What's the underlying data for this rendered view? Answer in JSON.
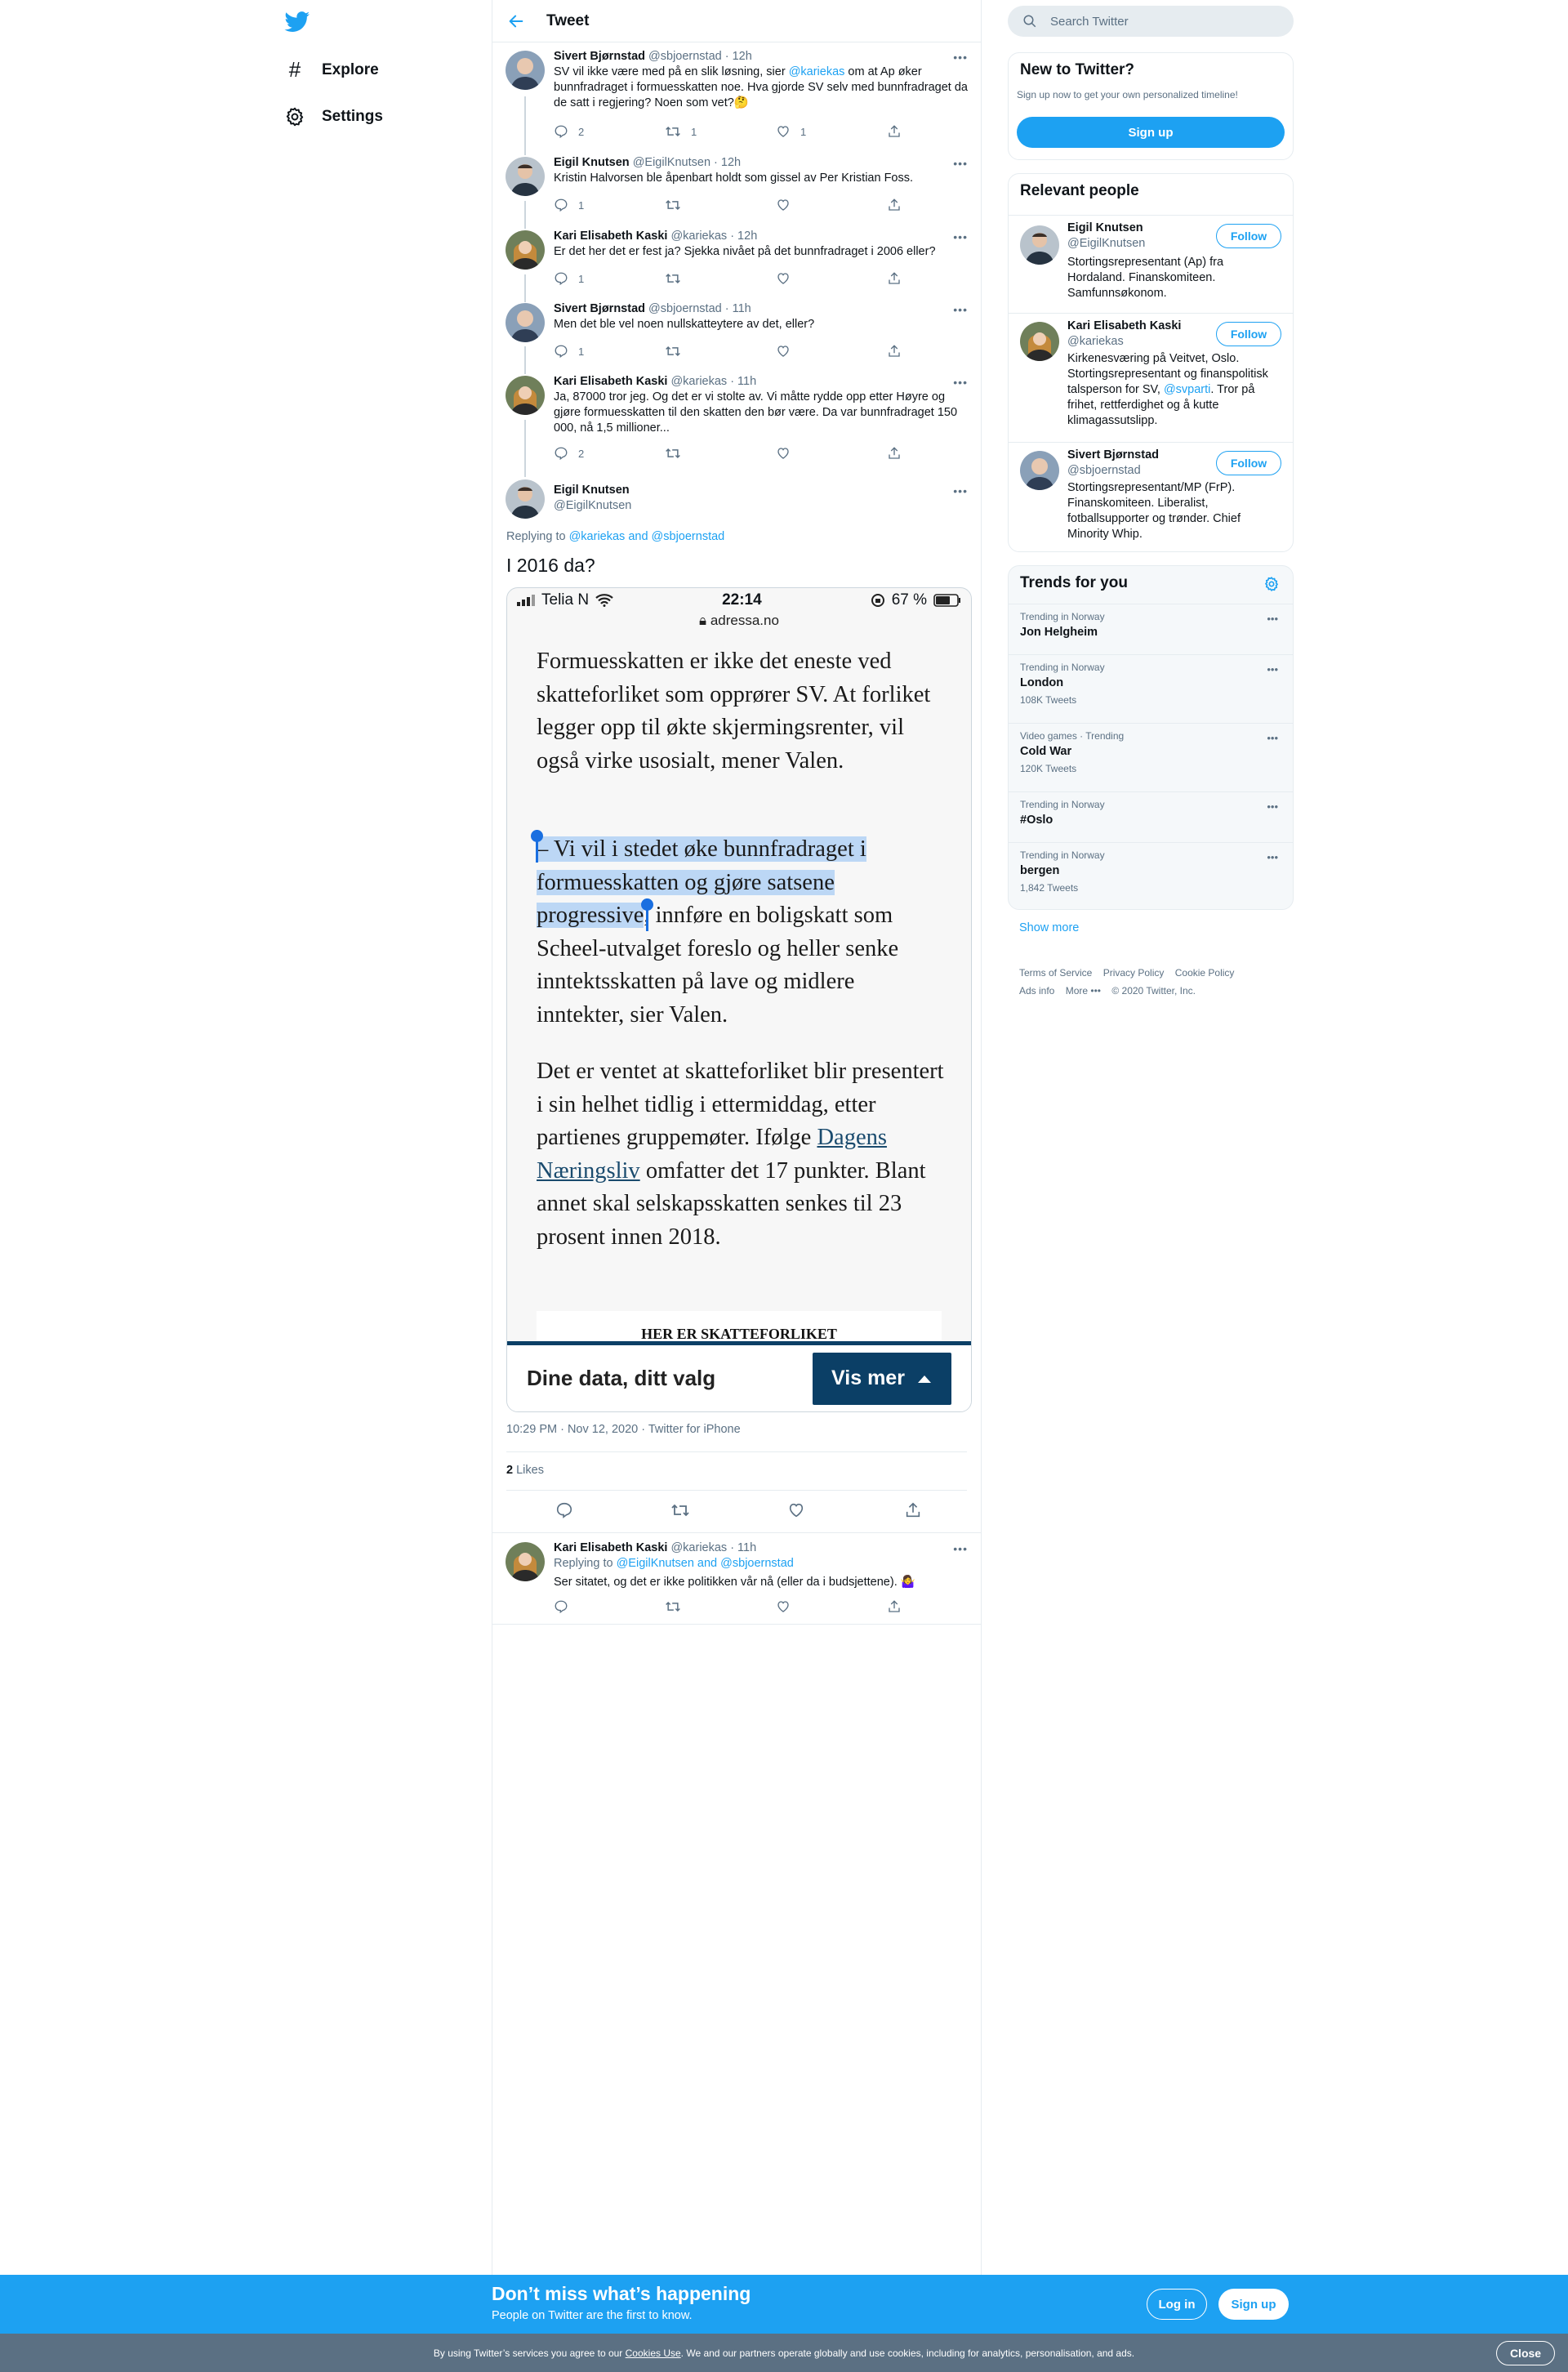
{
  "nav": {
    "explore": "Explore",
    "settings": "Settings"
  },
  "header": {
    "title": "Tweet"
  },
  "tweets": [
    {
      "name": "Sivert Bjørnstad",
      "handle": "@sbjoernstad",
      "time": "· 12h",
      "text_a": "SV vil ikke være med på en slik løsning, sier ",
      "mention": "@kariekas",
      "text_b": " om at Ap øker bunnfradraget i formuesskatten noe. Hva gjorde SV selv med bunnfradraget da de satt i regjering? Noen som vet?🤔",
      "replies": "2",
      "retweets": "1",
      "likes": "1"
    },
    {
      "name": "Eigil Knutsen",
      "handle": "@EigilKnutsen",
      "time": "· 12h",
      "text": "Kristin Halvorsen ble åpenbart holdt som gissel av Per Kristian Foss.",
      "replies": "1",
      "retweets": "",
      "likes": ""
    },
    {
      "name": "Kari Elisabeth Kaski",
      "handle": "@kariekas",
      "time": "· 12h",
      "text": "Er det her det er fest ja? Sjekka nivået på det bunnfradraget i 2006 eller?",
      "replies": "1",
      "retweets": "",
      "likes": ""
    },
    {
      "name": "Sivert Bjørnstad",
      "handle": "@sbjoernstad",
      "time": "· 11h",
      "text": "Men det ble vel noen nullskatteytere av det, eller?",
      "replies": "1",
      "retweets": "",
      "likes": ""
    },
    {
      "name": "Kari Elisabeth Kaski",
      "handle": "@kariekas",
      "time": "· 11h",
      "text": "Ja, 87000 tror jeg. Og det er vi stolte av. Vi måtte rydde opp etter Høyre og gjøre formuesskatten til den skatten den bør være. Da var bunnfradraget 150 000, nå 1,5 millioner...",
      "replies": "2",
      "retweets": "",
      "likes": ""
    }
  ],
  "main": {
    "name": "Eigil Knutsen",
    "handle": "@EigilKnutsen",
    "replying_prefix": "Replying to ",
    "replying_to": "@kariekas and @sbjoernstad",
    "text": "I 2016 da?",
    "meta": "10:29 PM · Nov 12, 2020 · Twitter for iPhone",
    "likes_count": "2",
    "likes_label": "Likes"
  },
  "screenshot": {
    "carrier": "Telia N",
    "time": "22:14",
    "battery": "67 %",
    "url": "adressa.no",
    "p1": "Formuesskatten er ikke det eneste ved skatteforliket som opprører SV. At forliket legger opp til økte skjermingsrenter, vil også virke usosialt, mener Valen.",
    "p2_hl": "– Vi vil i stedet øke bunnfradraget i formuesskatten og gjøre satsene progressive",
    "p2_rest": ", innføre en boligskatt som Scheel-utvalget foreslo og heller senke inntektsskatten på lave og midlere inntekter, sier Valen.",
    "p3_a": "Det er ventet at skatteforliket blir presentert i sin helhet tidlig i ettermiddag, etter partienes gruppemøter. Ifølge ",
    "p3_link": "Dagens Næringsliv",
    "p3_b": " omfatter det 17 punkter. Blant annet skal selskapsskatten senkes til 23 prosent innen 2018.",
    "box_title": "HER ER SKATTEFORLIKET",
    "banner_text": "Dine data, ditt valg",
    "banner_button": "Vis mer"
  },
  "reply": {
    "name": "Kari Elisabeth Kaski",
    "handle": "@kariekas",
    "time": "· 11h",
    "replying_prefix": "Replying to ",
    "replying_to": "@EigilKnutsen and @sbjoernstad",
    "text": "Ser sitatet, og det er ikke politikken vår nå (eller da i budsjettene). 🤷‍♀️"
  },
  "sidebar": {
    "search_placeholder": "Search Twitter",
    "new_title": "New to Twitter?",
    "new_sub": "Sign up now to get your own personalized timeline!",
    "signup": "Sign up",
    "relevant_title": "Relevant people",
    "follow": "Follow",
    "people": [
      {
        "name": "Eigil Knutsen",
        "handle": "@EigilKnutsen",
        "bio": "Stortingsrepresentant (Ap) fra Hordaland. Finanskomiteen. Samfunnsøkonom."
      },
      {
        "name": "Kari Elisabeth Kaski",
        "handle": "@kariekas",
        "bio_a": "Kirkenesværing på Veitvet, Oslo. Stortingsrepresentant og finanspolitisk talsperson for SV, ",
        "bio_link": "@svparti",
        "bio_b": ". Tror på frihet, rettferdighet og å kutte klimagassutslipp."
      },
      {
        "name": "Sivert Bjørnstad",
        "handle": "@sbjoernstad",
        "bio": "Stortingsrepresentant/MP (FrP). Finanskomiteen. Liberalist, fotballsupporter og trønder. Chief Minority Whip."
      }
    ],
    "trends_title": "Trends for you",
    "trends": [
      {
        "context": "Trending in Norway",
        "name": "Jon Helgheim",
        "count": ""
      },
      {
        "context": "Trending in Norway",
        "name": "London",
        "count": "108K Tweets"
      },
      {
        "context": "Video games · Trending",
        "name": "Cold War",
        "count": "120K Tweets"
      },
      {
        "context": "Trending in Norway",
        "name": "#Oslo",
        "count": ""
      },
      {
        "context": "Trending in Norway",
        "name": "bergen",
        "count": "1,842 Tweets"
      }
    ],
    "show_more": "Show more",
    "footer": {
      "terms": "Terms of Service",
      "privacy": "Privacy Policy",
      "cookie": "Cookie Policy",
      "ads": "Ads info",
      "more": "More",
      "copyright": "© 2020 Twitter, Inc."
    }
  },
  "banner": {
    "title": "Don’t miss what’s happening",
    "sub": "People on Twitter are the first to know.",
    "login": "Log in",
    "signup": "Sign up"
  },
  "cookie": {
    "a": "By using Twitter’s services you agree to our ",
    "link": "Cookies Use",
    "b": ". We and our partners operate globally and use cookies, including for analytics, personalisation, and ads.",
    "close": "Close"
  },
  "colors": {
    "accent": "#1da1f2",
    "text": "#0f1419",
    "secondary": "#5b7083",
    "border": "#e6ecf0",
    "adressa_navy": "#0b3f66"
  }
}
